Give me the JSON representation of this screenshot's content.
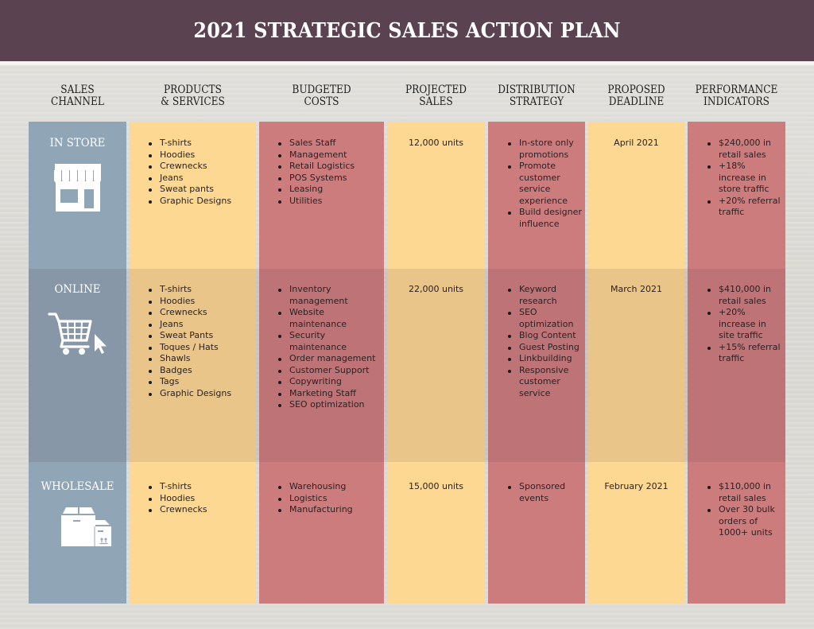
{
  "title": "2021 STRATEGIC SALES ACTION PLAN",
  "colors": {
    "title_bar": "#5a4251",
    "channel_column": "#90a5b5",
    "yellow_column": "#fdd893",
    "red_column": "#cd7c7d"
  },
  "headers": [
    {
      "line1": "SALES",
      "line2": "CHANNEL"
    },
    {
      "line1": "PRODUCTS",
      "line2": "& SERVICES"
    },
    {
      "line1": "BUDGETED",
      "line2": "COSTS"
    },
    {
      "line1": "PROJECTED",
      "line2": "SALES"
    },
    {
      "line1": "DISTRIBUTION",
      "line2": "STRATEGY"
    },
    {
      "line1": "PROPOSED",
      "line2": "DEADLINE"
    },
    {
      "line1": "PERFORMANCE",
      "line2": "INDICATORS"
    }
  ],
  "rows": [
    {
      "channel": "IN STORE",
      "icon": "storefront-icon",
      "products": [
        "T-shirts",
        "Hoodies",
        "Crewnecks",
        "Jeans",
        "Sweat pants",
        "Graphic Designs"
      ],
      "costs": [
        "Sales Staff",
        "Management",
        "Retail Logistics",
        "POS Systems",
        "Leasing",
        "Utilities"
      ],
      "projected_sales": "12,000 units",
      "distribution": [
        "In-store only promotions",
        "Promote customer service experience",
        "Build designer influence"
      ],
      "deadline": "April 2021",
      "indicators": [
        "$240,000 in retail sales",
        "+18% increase in store traffic",
        "+20% referral traffic"
      ]
    },
    {
      "channel": "ONLINE",
      "icon": "shopping-cart-icon",
      "products": [
        "T-shirts",
        "Hoodies",
        "Crewnecks",
        "Jeans",
        "Sweat Pants",
        "Toques / Hats",
        "Shawls",
        "Badges",
        "Tags",
        "Graphic Designs"
      ],
      "costs": [
        "Inventory management",
        "Website maintenance",
        "Security maintenance",
        "Order management",
        "Customer Support",
        "Copywriting",
        "Marketing Staff",
        "SEO optimization"
      ],
      "projected_sales": "22,000 units",
      "distribution": [
        "Keyword research",
        "SEO optimization",
        "Blog Content",
        "Guest Posting",
        "Linkbuilding",
        "Responsive customer service"
      ],
      "deadline": "March 2021",
      "indicators": [
        "$410,000 in retail sales",
        "+20% increase in site traffic",
        "+15% referral traffic"
      ]
    },
    {
      "channel": "WHOLESALE",
      "icon": "boxes-icon",
      "products": [
        "T-shirts",
        "Hoodies",
        "Crewnecks"
      ],
      "costs": [
        "Warehousing",
        "Logistics",
        "Manufacturing"
      ],
      "projected_sales": "15,000 units",
      "distribution": [
        "Sponsored events"
      ],
      "deadline": "February 2021",
      "indicators": [
        "$110,000 in retail sales",
        "Over 30 bulk orders of 1000+ units"
      ]
    }
  ]
}
